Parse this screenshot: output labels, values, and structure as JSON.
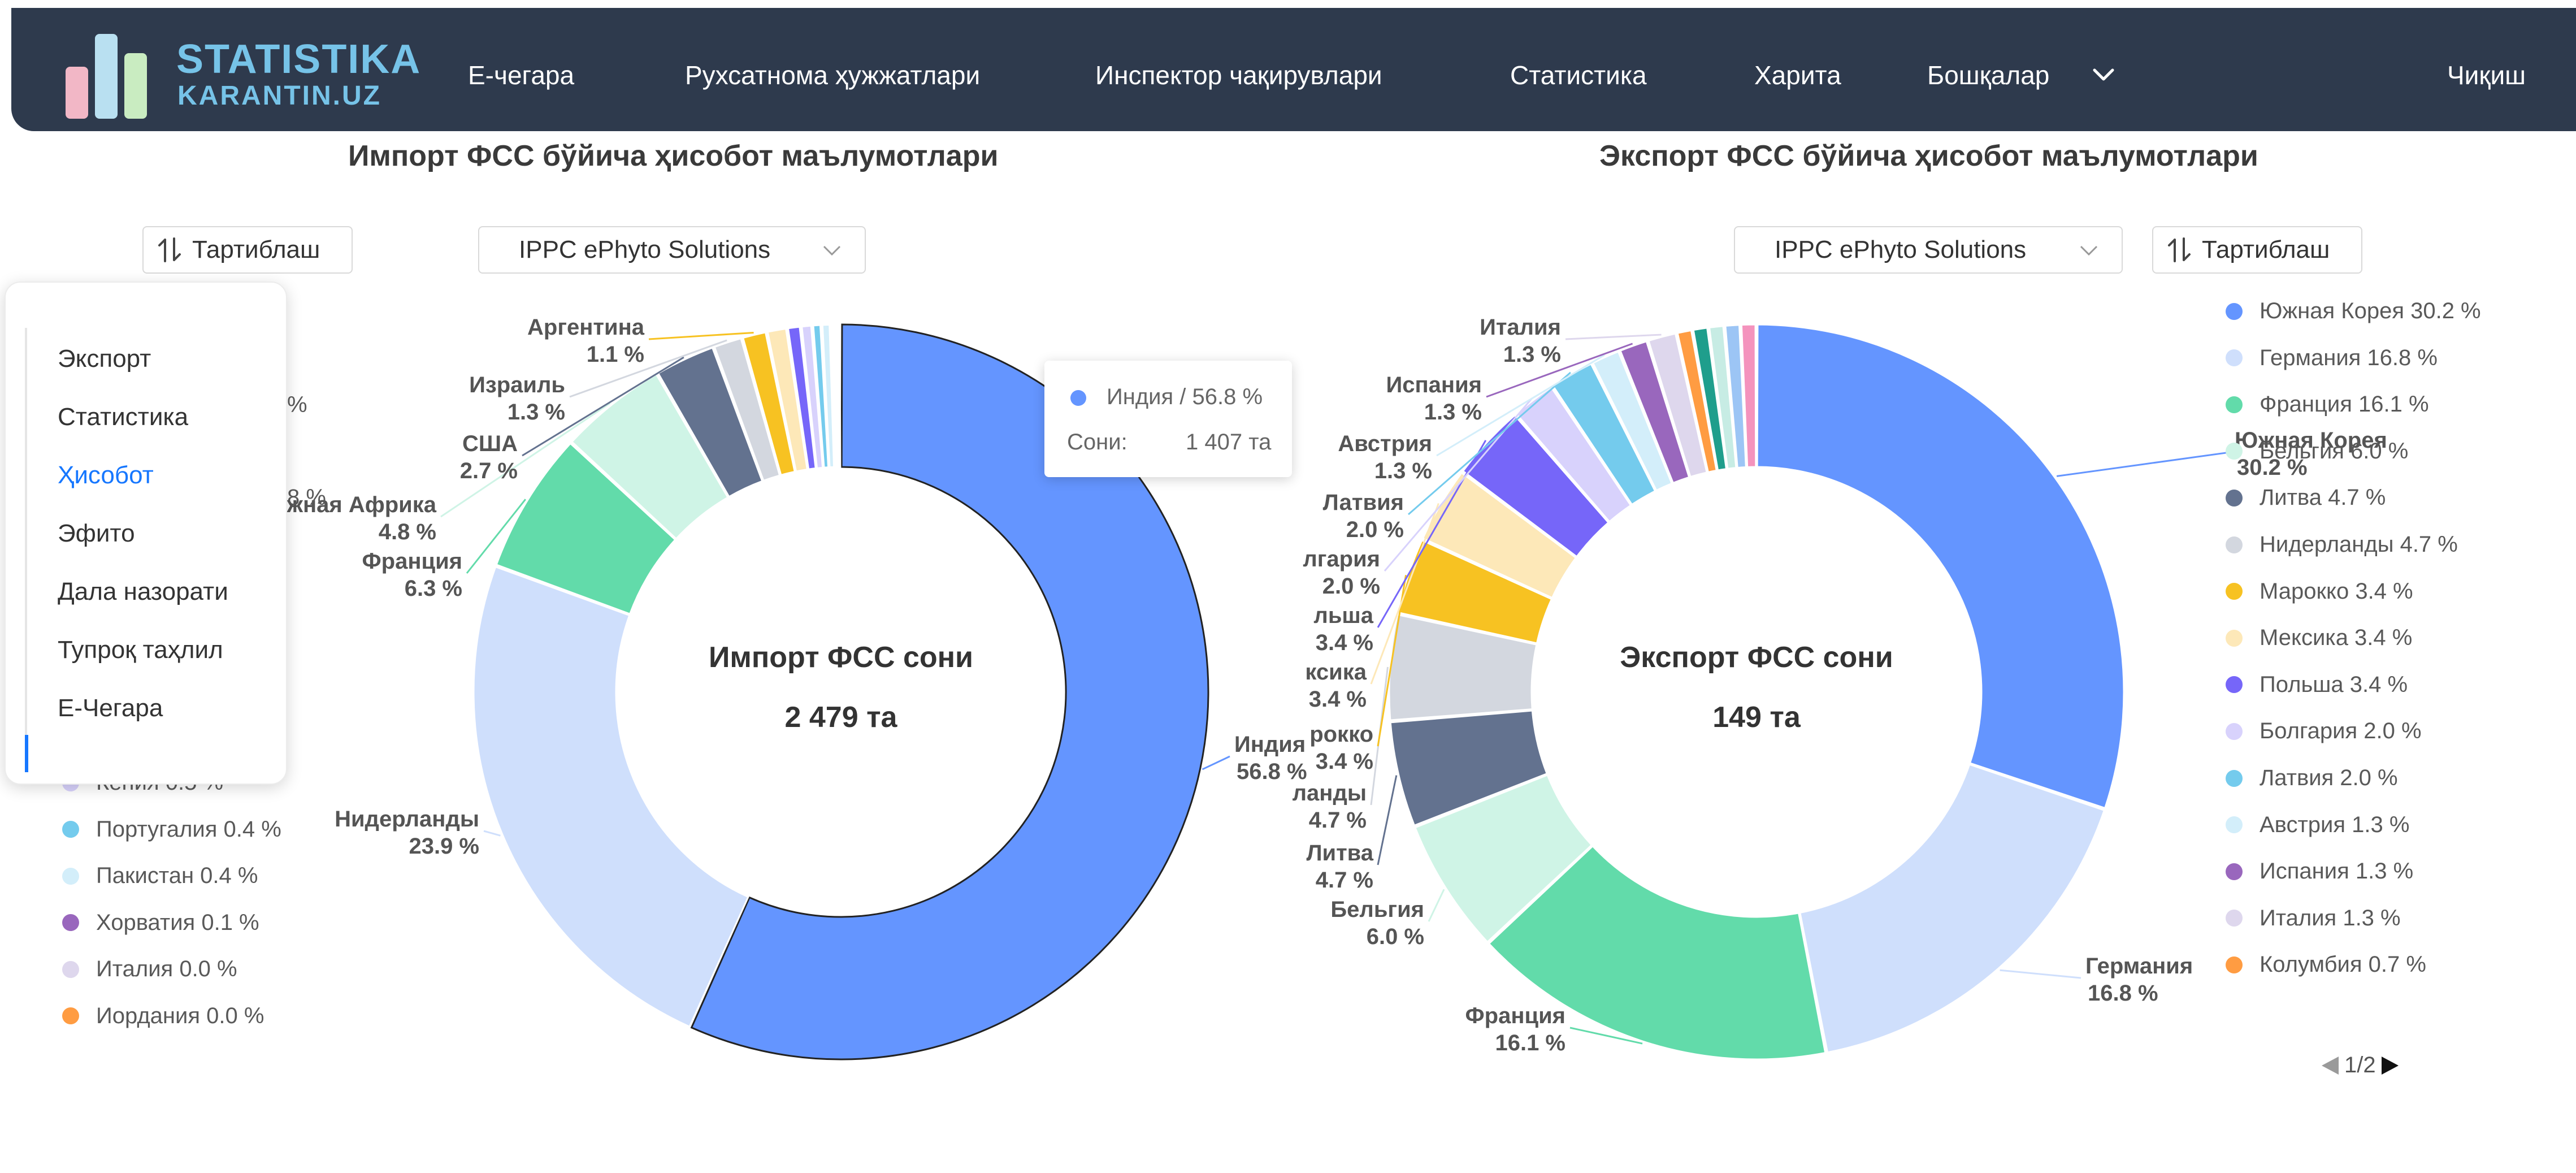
{
  "nav": {
    "logo_title": "STATISTIKA",
    "logo_subtitle": "KARANTIN.UZ",
    "items": [
      "Е-чегара",
      "Рухсатнома ҳужжатлари",
      "Инспектор чақирувлари",
      "Статистика",
      "Харита",
      "Бошқалар"
    ],
    "logout": "Чиқиш"
  },
  "side_menu": {
    "items": [
      "Экспорт",
      "Статистика",
      "Ҳисобот",
      "Эфито",
      "Дала назорати",
      "Тупроқ таҳлил",
      "Е-Чегара"
    ],
    "active": "Ҳисобот"
  },
  "controls": {
    "sort_label": "Тартиблаш",
    "select_value": "IPPC ePhyto Solutions"
  },
  "tooltip": {
    "name": "Индия / 56.8 %",
    "count_label": "Сони:",
    "count_value": "1 407 та",
    "color": "#6495ff"
  },
  "pager": {
    "text": "1/2"
  },
  "chart_data": [
    {
      "type": "pie",
      "title": "Импорт ФСС бўйича ҳисобот маълумотлари",
      "center_label": "Импорт ФСС сони",
      "center_value": "2 479 та",
      "slices": [
        {
          "name": "Индия",
          "value": 56.8,
          "color": "#6495ff"
        },
        {
          "name": "Нидерланды",
          "value": 23.9,
          "color": "#cfdffc"
        },
        {
          "name": "Франция",
          "value": 6.3,
          "color": "#62dbaa"
        },
        {
          "name": "Южная Африка",
          "value": 4.8,
          "color": "#cff4e6"
        },
        {
          "name": "США",
          "value": 2.7,
          "color": "#63728f"
        },
        {
          "name": "Израиль",
          "value": 1.3,
          "color": "#d3d7df"
        },
        {
          "name": "Аргентина",
          "value": 1.1,
          "color": "#f7c222"
        },
        {
          "name": "",
          "value": 0.9,
          "color": "#fde8b8"
        },
        {
          "name": "",
          "value": 0.6,
          "color": "#7666f9"
        },
        {
          "name": "Кения",
          "value": 0.5,
          "color": "#d8d2fc"
        },
        {
          "name": "Португалия",
          "value": 0.4,
          "color": "#74cbed"
        },
        {
          "name": "Пакистан",
          "value": 0.4,
          "color": "#d3eefa"
        },
        {
          "name": "Хорватия",
          "value": 0.1,
          "color": "#9967bd"
        },
        {
          "name": "Италия",
          "value": 0.0,
          "color": "#ded7ed"
        },
        {
          "name": "Иордания",
          "value": 0.0,
          "color": "#ff9c42"
        }
      ],
      "outer_labels": [
        {
          "name": "Индия",
          "pct": "56.8 %"
        },
        {
          "name": "Нидерланды",
          "pct": "23.9 %"
        },
        {
          "name": "Франция",
          "pct": "6.3 %"
        },
        {
          "name": "Южная Африка",
          "pct": "4.8 %"
        },
        {
          "name": "США",
          "pct": "2.7 %"
        },
        {
          "name": "Израиль",
          "pct": "1.3 %"
        },
        {
          "name": "Аргентина",
          "pct": "1.1 %"
        }
      ],
      "legend": [
        {
          "name": "Кения",
          "pct": "0.5 %",
          "color": "#d8d2fc"
        },
        {
          "name": "Португалия",
          "pct": "0.4 %",
          "color": "#74cbed"
        },
        {
          "name": "Пакистан",
          "pct": "0.4 %",
          "color": "#d3eefa"
        },
        {
          "name": "Хорватия",
          "pct": "0.1 %",
          "color": "#9967bd"
        },
        {
          "name": "Италия",
          "pct": "0.0 %",
          "color": "#ded7ed"
        },
        {
          "name": "Иордания",
          "pct": "0.0 %",
          "color": "#ff9c42"
        }
      ],
      "legend_fragments": [
        "%",
        "8 %",
        "Кения 0.5 %"
      ]
    },
    {
      "type": "pie",
      "title": "Экспорт ФСС бўйича ҳисобот маълумотлари",
      "center_label": "Экспорт ФСС сони",
      "center_value": "149 та",
      "slices": [
        {
          "name": "Южная Корея",
          "value": 30.2,
          "color": "#6495ff"
        },
        {
          "name": "Германия",
          "value": 16.8,
          "color": "#cfdffc"
        },
        {
          "name": "Франция",
          "value": 16.1,
          "color": "#62dbaa"
        },
        {
          "name": "Бельгия",
          "value": 6.0,
          "color": "#cff4e6"
        },
        {
          "name": "Литва",
          "value": 4.7,
          "color": "#63728f"
        },
        {
          "name": "Нидерланды",
          "value": 4.7,
          "color": "#d3d7df"
        },
        {
          "name": "Марокко",
          "value": 3.4,
          "color": "#f7c222"
        },
        {
          "name": "Мексика",
          "value": 3.4,
          "color": "#fde8b8"
        },
        {
          "name": "Польша",
          "value": 3.4,
          "color": "#7666f9"
        },
        {
          "name": "Болгария",
          "value": 2.0,
          "color": "#d8d2fc"
        },
        {
          "name": "Латвия",
          "value": 2.0,
          "color": "#74cbed"
        },
        {
          "name": "Австрия",
          "value": 1.3,
          "color": "#d3eefa"
        },
        {
          "name": "Испания",
          "value": 1.3,
          "color": "#9967bd"
        },
        {
          "name": "Италия",
          "value": 1.3,
          "color": "#ded7ed"
        },
        {
          "name": "Колумбия",
          "value": 0.7,
          "color": "#ff9c42"
        },
        {
          "name": "",
          "value": 0.7,
          "color": "#1f9e8c"
        },
        {
          "name": "",
          "value": 0.7,
          "color": "#c7ece4"
        },
        {
          "name": "",
          "value": 0.7,
          "color": "#9cc5f5"
        },
        {
          "name": "",
          "value": 0.7,
          "color": "#f493bd"
        }
      ],
      "outer_labels": [
        {
          "name": "Южная Корея",
          "pct": "30.2 %"
        },
        {
          "name": "Германия",
          "pct": "16.8 %"
        },
        {
          "name": "Франция",
          "pct": "16.1 %"
        },
        {
          "name": "Бельгия",
          "pct": "6.0 %"
        },
        {
          "name": "Литва",
          "pct": "4.7 %"
        },
        {
          "name": "ланды",
          "pct": "4.7 %"
        },
        {
          "name": "рокко",
          "pct": "3.4 %"
        },
        {
          "name": "ксика",
          "pct": "3.4 %"
        },
        {
          "name": "льша",
          "pct": "3.4 %"
        },
        {
          "name": "лгария",
          "pct": "2.0 %"
        },
        {
          "name": "Латвия",
          "pct": "2.0 %"
        },
        {
          "name": "Австрия",
          "pct": "1.3 %"
        },
        {
          "name": "Испания",
          "pct": "1.3 %"
        },
        {
          "name": "Италия",
          "pct": "1.3 %"
        }
      ],
      "legend": [
        {
          "name": "Южная Корея",
          "pct": "30.2 %",
          "color": "#6495ff"
        },
        {
          "name": "Германия",
          "pct": "16.8 %",
          "color": "#cfdffc"
        },
        {
          "name": "Франция",
          "pct": "16.1 %",
          "color": "#62dbaa"
        },
        {
          "name": "Бельгия",
          "pct": "6.0 %",
          "color": "#cff4e6"
        },
        {
          "name": "Литва",
          "pct": "4.7 %",
          "color": "#63728f"
        },
        {
          "name": "Нидерланды",
          "pct": "4.7 %",
          "color": "#d3d7df"
        },
        {
          "name": "Марокко",
          "pct": "3.4 %",
          "color": "#f7c222"
        },
        {
          "name": "Мексика",
          "pct": "3.4 %",
          "color": "#fde8b8"
        },
        {
          "name": "Польша",
          "pct": "3.4 %",
          "color": "#7666f9"
        },
        {
          "name": "Болгария",
          "pct": "2.0 %",
          "color": "#d8d2fc"
        },
        {
          "name": "Латвия",
          "pct": "2.0 %",
          "color": "#74cbed"
        },
        {
          "name": "Австрия",
          "pct": "1.3 %",
          "color": "#d3eefa"
        },
        {
          "name": "Испания",
          "pct": "1.3 %",
          "color": "#9967bd"
        },
        {
          "name": "Италия",
          "pct": "1.3 %",
          "color": "#ded7ed"
        },
        {
          "name": "Колумбия",
          "pct": "0.7 %",
          "color": "#ff9c42"
        }
      ]
    }
  ]
}
